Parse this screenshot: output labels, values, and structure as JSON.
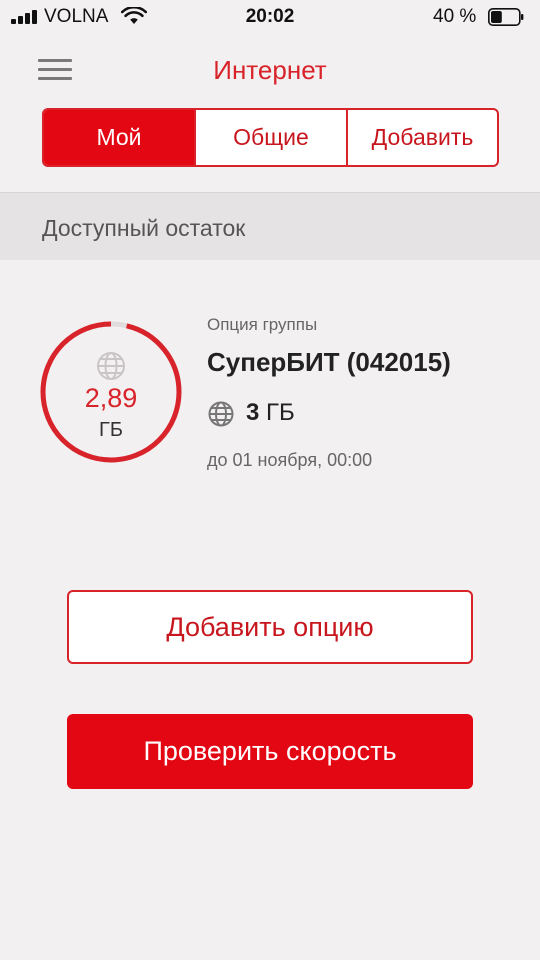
{
  "status_bar": {
    "carrier": "VOLNA",
    "time": "20:02",
    "battery_percent": "40 %",
    "battery_level": 0.4
  },
  "header": {
    "title": "Интернет",
    "menu_icon": "hamburger-menu-icon"
  },
  "tabs": [
    {
      "label": "Мой",
      "active": true
    },
    {
      "label": "Общие",
      "active": false
    },
    {
      "label": "Добавить",
      "active": false
    }
  ],
  "section": {
    "title": "Доступный остаток"
  },
  "gauge": {
    "value": "2,89",
    "unit": "ГБ",
    "remaining_fraction": 0.963,
    "icon": "globe-icon"
  },
  "option": {
    "group_label": "Опция группы",
    "name": "СуперБИТ (042015)",
    "amount_value": "3",
    "amount_unit": "ГБ",
    "valid_until": "до 01 ноября, 00:00",
    "icon": "globe-icon"
  },
  "buttons": {
    "add_option": "Добавить опцию",
    "check_speed": "Проверить скорость"
  },
  "colors": {
    "accent": "#e30613",
    "accent_text": "#d8232a",
    "background": "#f3f0f1",
    "section_bg": "#e6e3e4",
    "gauge_track": "#e0dcdd"
  }
}
